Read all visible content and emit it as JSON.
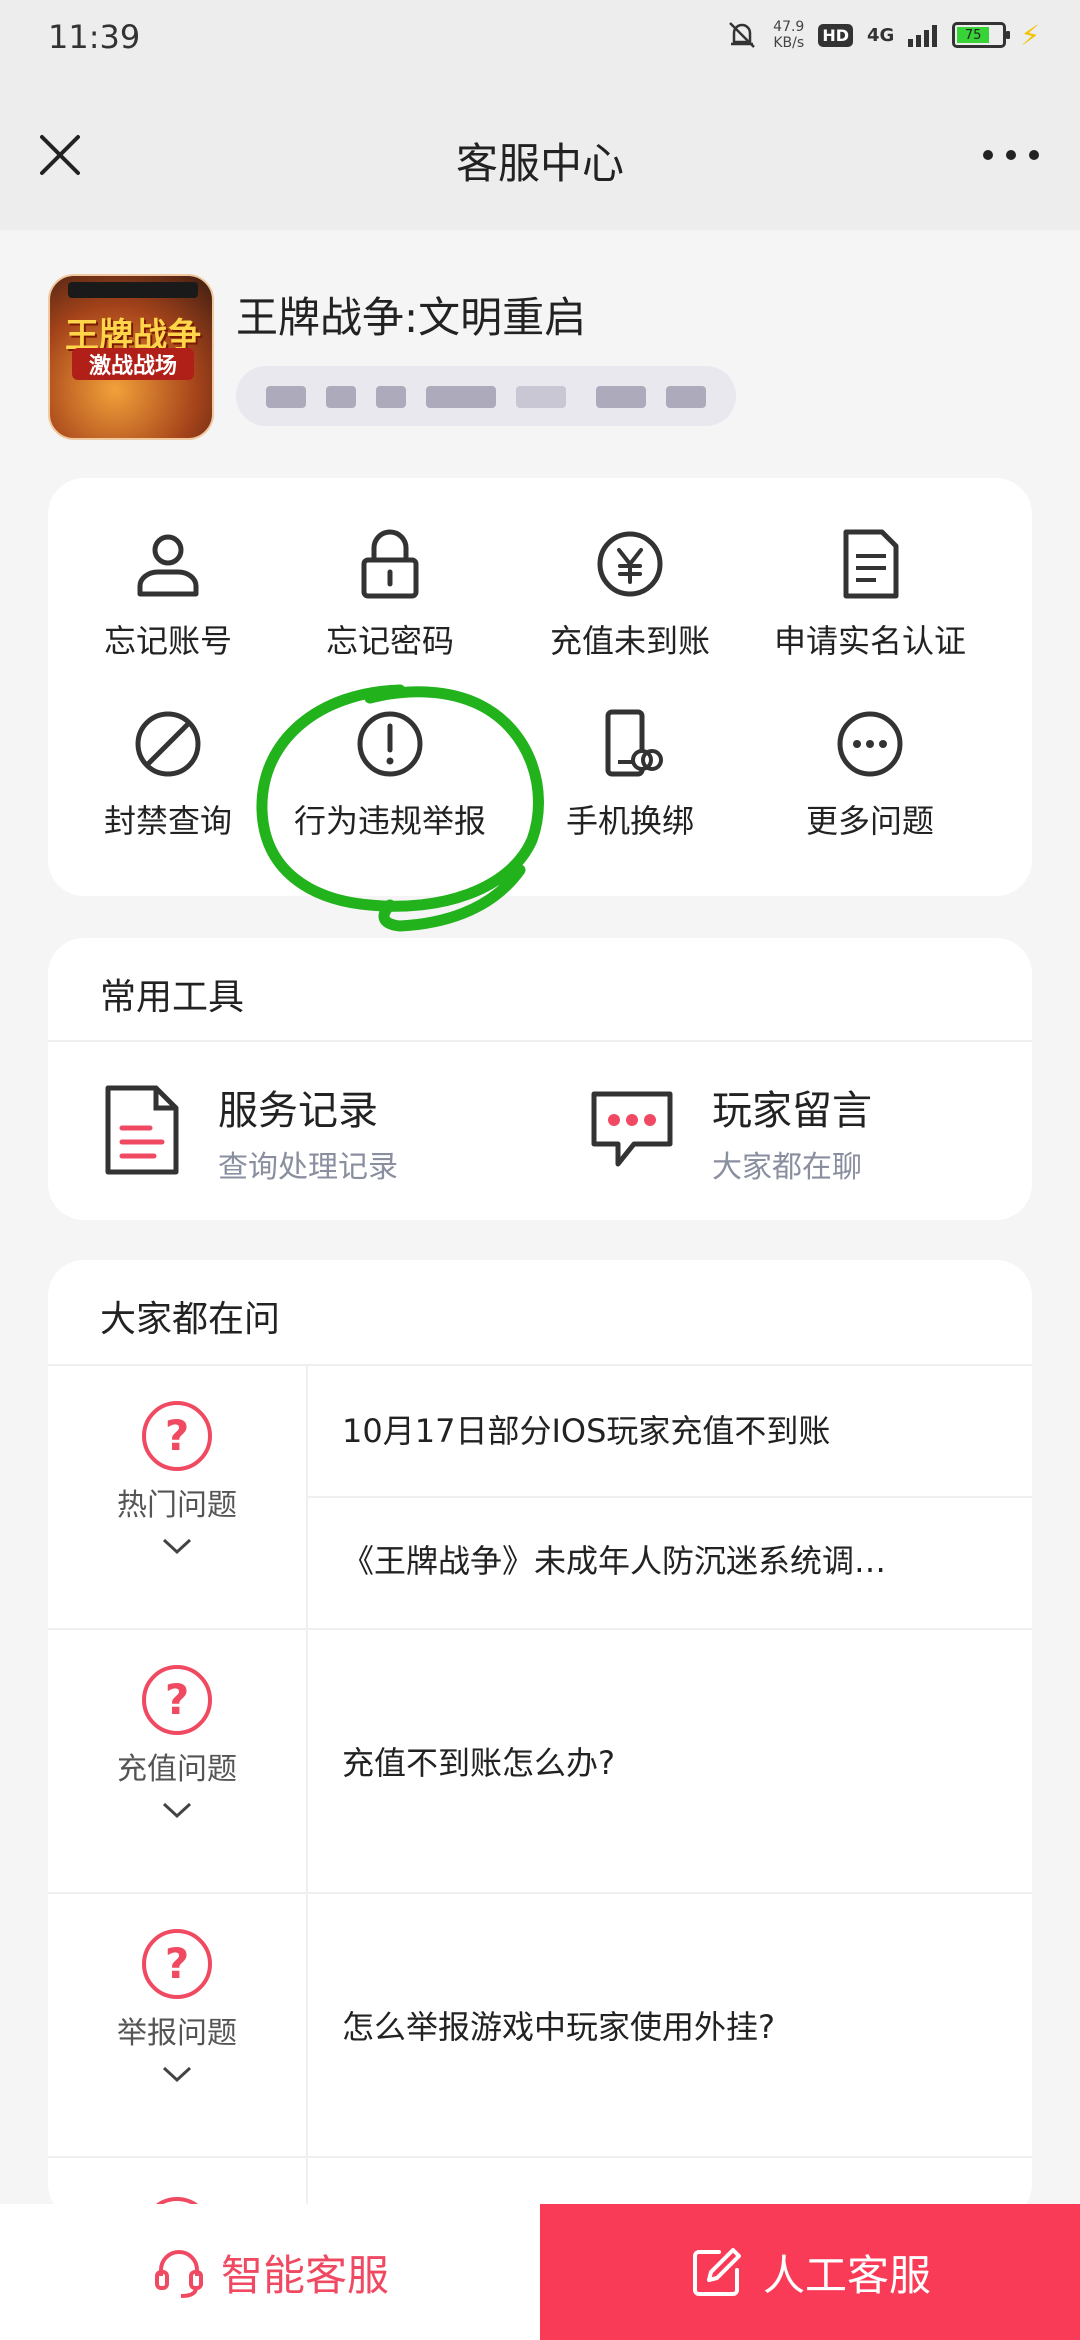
{
  "status_bar": {
    "time": "11:39",
    "net_speed_value": "47.9",
    "net_speed_unit": "KB/s",
    "hd": "HD",
    "network": "4G",
    "battery": "75"
  },
  "nav": {
    "title": "客服中心"
  },
  "game": {
    "title": "王牌战争:文明重启",
    "logo_text": "王牌战争",
    "logo_sub": "激战战场"
  },
  "quick_actions": [
    {
      "label": "忘记账号",
      "icon": "user-icon"
    },
    {
      "label": "忘记密码",
      "icon": "lock-icon"
    },
    {
      "label": "充值未到账",
      "icon": "yen-icon"
    },
    {
      "label": "申请实名认证",
      "icon": "document-icon"
    },
    {
      "label": "封禁查询",
      "icon": "ban-icon"
    },
    {
      "label": "行为违规举报",
      "icon": "alert-icon"
    },
    {
      "label": "手机换绑",
      "icon": "phone-link-icon"
    },
    {
      "label": "更多问题",
      "icon": "more-icon"
    }
  ],
  "tools": {
    "title": "常用工具",
    "items": [
      {
        "title": "服务记录",
        "subtitle": "查询处理记录",
        "icon": "record-icon"
      },
      {
        "title": "玩家留言",
        "subtitle": "大家都在聊",
        "icon": "chat-icon"
      }
    ]
  },
  "faq": {
    "title": "大家都在问",
    "sections": [
      {
        "category": "热门问题",
        "questions": [
          "10月17日部分IOS玩家充值不到账",
          "《王牌战争》未成年人防沉迷系统调…"
        ]
      },
      {
        "category": "充值问题",
        "questions": [
          "充值不到账怎么办?"
        ]
      },
      {
        "category": "举报问题",
        "questions": [
          "怎么举报游戏中玩家使用外挂?"
        ]
      }
    ]
  },
  "bottom": {
    "smart_label": "智能客服",
    "human_label": "人工客服"
  },
  "colors": {
    "accent": "#fa3b57",
    "accent_text": "#f04a63",
    "highlight_circle": "#22b21c",
    "icon_gray": "#444444"
  }
}
